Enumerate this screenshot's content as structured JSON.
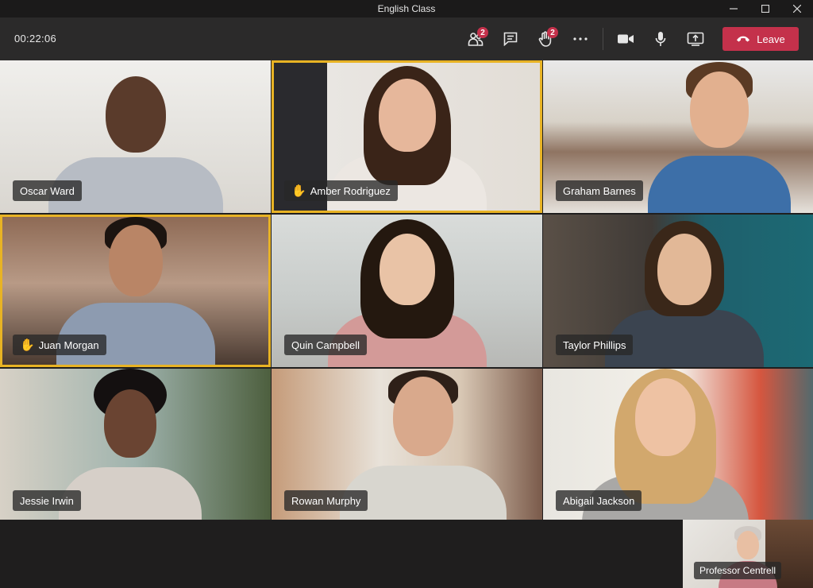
{
  "window": {
    "title": "English Class"
  },
  "toolbar": {
    "timer": "00:22:06",
    "participants_badge": "2",
    "raised_hands_badge": "2",
    "leave_label": "Leave"
  },
  "participants": [
    {
      "name": "Oscar Ward",
      "hand_raised": false,
      "speaking": false
    },
    {
      "name": "Amber Rodriguez",
      "hand_raised": true,
      "speaking": true
    },
    {
      "name": "Graham Barnes",
      "hand_raised": false,
      "speaking": false
    },
    {
      "name": "Juan Morgan",
      "hand_raised": true,
      "speaking": true
    },
    {
      "name": "Quin Campbell",
      "hand_raised": false,
      "speaking": false
    },
    {
      "name": "Taylor Phillips",
      "hand_raised": false,
      "speaking": false
    },
    {
      "name": "Jessie Irwin",
      "hand_raised": false,
      "speaking": false
    },
    {
      "name": "Rowan Murphy",
      "hand_raised": false,
      "speaking": false
    },
    {
      "name": "Abigail Jackson",
      "hand_raised": false,
      "speaking": false
    }
  ],
  "self_view": {
    "name": "Professor Centrell"
  },
  "colors": {
    "leave": "#c4314b",
    "active_border": "#e8b324",
    "badge": "#c4314b"
  }
}
